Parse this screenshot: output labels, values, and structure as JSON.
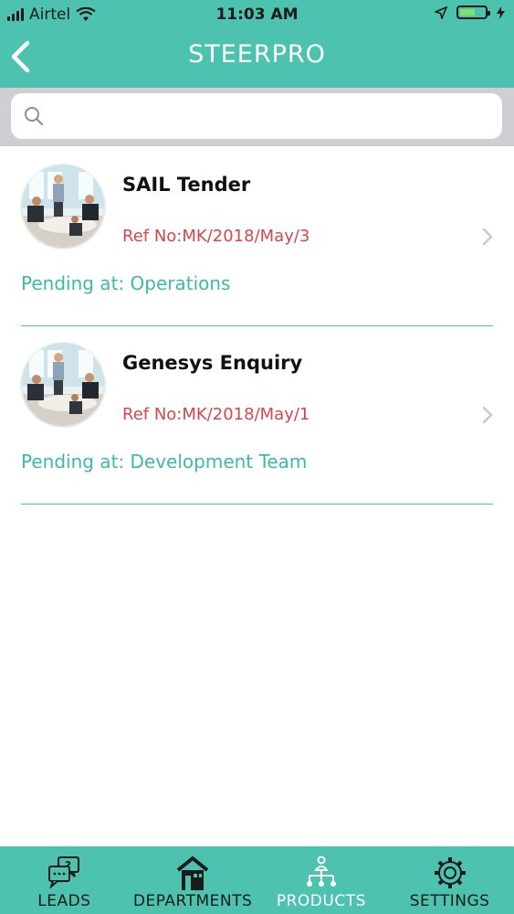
{
  "status_bar": {
    "carrier": "Airtel",
    "time": "11:03 AM",
    "battery_level": 0.6,
    "battery_color": "#7ee36b"
  },
  "header": {
    "title": "STEERPRO",
    "back_icon": "chevron-left-icon",
    "background": "#4dc2ae"
  },
  "search": {
    "placeholder": "",
    "value": "",
    "icon": "search-icon"
  },
  "items": [
    {
      "title": "SAIL Tender",
      "ref": "Ref No:MK/2018/May/3",
      "pending": "Pending at: Operations"
    },
    {
      "title": "Genesys Enquiry",
      "ref": "Ref No:MK/2018/May/1",
      "pending": "Pending at: Development Team"
    }
  ],
  "tabs": [
    {
      "label": "LEADS",
      "icon": "chat-question-icon",
      "active": false
    },
    {
      "label": "DEPARTMENTS",
      "icon": "building-icon",
      "active": false
    },
    {
      "label": "PRODUCTS",
      "icon": "hierarchy-icon",
      "active": true
    },
    {
      "label": "SETTINGS",
      "icon": "gear-icon",
      "active": false
    }
  ],
  "colors": {
    "accent": "#4dc2ae",
    "ref_text": "#d8454a",
    "pending_text": "#3dbaa6"
  }
}
